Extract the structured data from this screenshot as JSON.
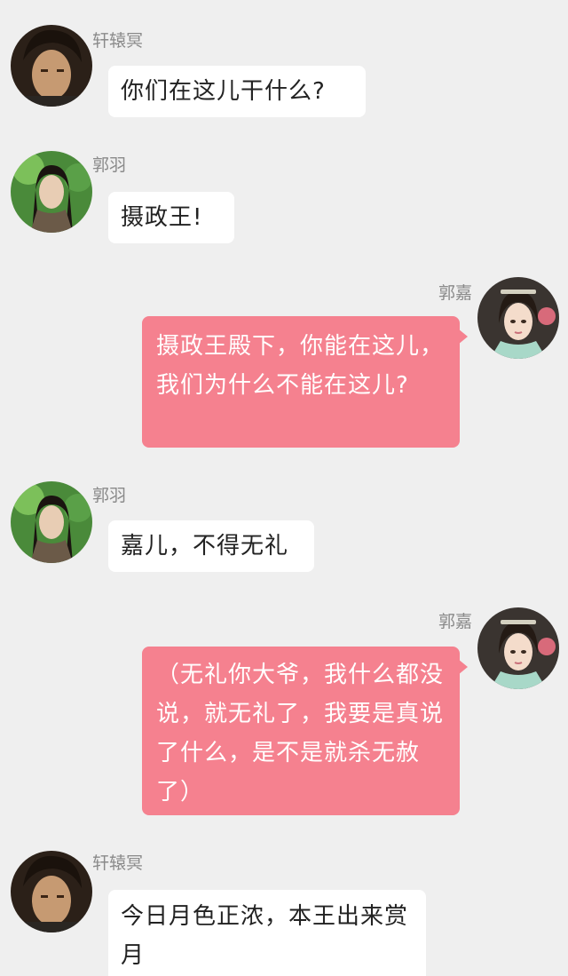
{
  "messages": [
    {
      "sender": "轩辕冥",
      "text": "你们在这儿干什么?",
      "side": "left",
      "avatar": "xuanyuan-ming-avatar"
    },
    {
      "sender": "郭羽",
      "text": "摄政王!",
      "side": "left",
      "avatar": "guo-yu-avatar"
    },
    {
      "sender": "郭嘉",
      "text": "摄政王殿下，你能在这儿，我们为什么不能在这儿?",
      "side": "right",
      "avatar": "guo-jia-avatar"
    },
    {
      "sender": "郭羽",
      "text": "嘉儿，不得无礼",
      "side": "left",
      "avatar": "guo-yu-avatar"
    },
    {
      "sender": "郭嘉",
      "text": "（无礼你大爷，我什么都没说，就无礼了，我要是真说了什么，是不是就杀无赦了）",
      "side": "right",
      "avatar": "guo-jia-avatar"
    },
    {
      "sender": "轩辕冥",
      "text": "今日月色正浓，本王出来赏月",
      "side": "left",
      "avatar": "xuanyuan-ming-avatar"
    }
  ],
  "colors": {
    "background": "#efefef",
    "bubble_white": "#ffffff",
    "bubble_pink": "#f5818f",
    "sender_name": "#8a8a8a"
  }
}
